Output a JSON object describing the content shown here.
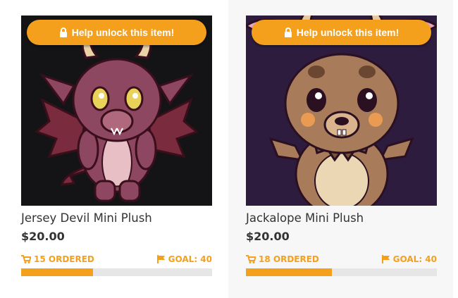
{
  "products": [
    {
      "unlock_label": "Help unlock this item!",
      "name": "Jersey Devil Mini Plush",
      "price": "$20.00",
      "ordered_text": "15 ORDERED",
      "goal_text": "GOAL: 40",
      "ordered": 15,
      "goal": 40
    },
    {
      "unlock_label": "Help unlock this item!",
      "name": "Jackalope Mini Plush",
      "price": "$20.00",
      "ordered_text": "18 ORDERED",
      "goal_text": "GOAL: 40",
      "ordered": 18,
      "goal": 40
    }
  ],
  "colors": {
    "accent": "#f5a01d",
    "track": "#e6e6e6",
    "text": "#333333"
  },
  "icons": {
    "unlock": "lock-icon",
    "ordered": "shopping-cart-icon",
    "goal": "flag-icon"
  }
}
